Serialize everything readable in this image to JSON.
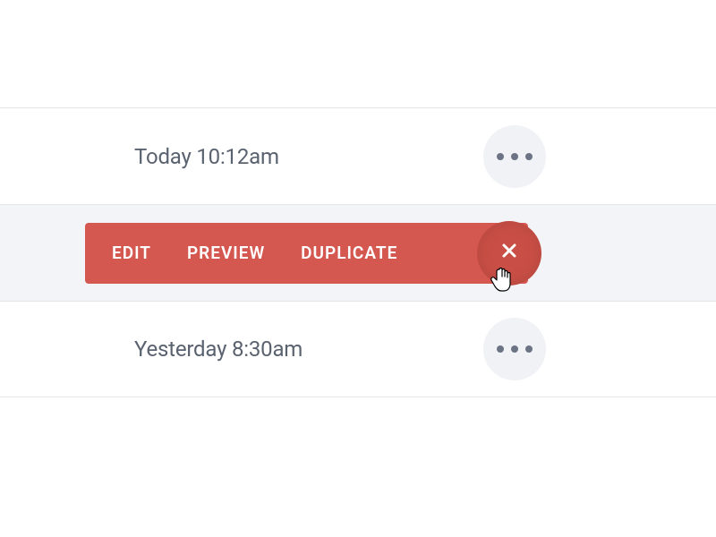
{
  "rows": [
    {
      "timestamp": "Today 10:12am"
    },
    {
      "timestamp": ""
    },
    {
      "timestamp": "Yesterday 8:30am"
    }
  ],
  "actions": {
    "edit": "EDIT",
    "preview": "PREVIEW",
    "duplicate": "DUPLICATE"
  }
}
